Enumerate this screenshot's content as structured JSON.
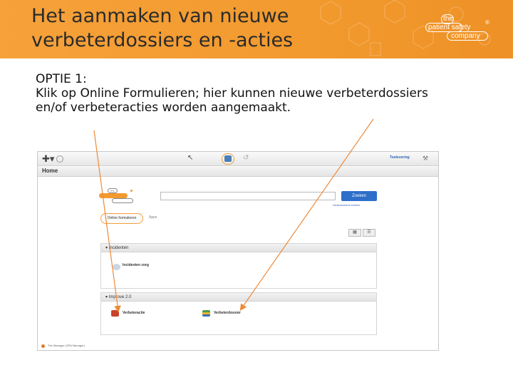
{
  "slide": {
    "title_line1": "Het aanmaken van nieuwe",
    "title_line2": "verbeterdossiers en -acties",
    "body_line1": "OPTIE 1:",
    "body_line2": "Klik op Online Formulieren; hier kunnen nieuwe verbeterdossiers",
    "body_line3": "en/of verbeteracties worden aangemaakt."
  },
  "logo": {
    "word1": "the",
    "word2": "patient safety",
    "word3": "company",
    "registered": "®"
  },
  "screenshot": {
    "toolbar": {
      "user_link": "Toelevering"
    },
    "home_title": "Home",
    "mini_logo_text": "the",
    "search": {
      "placeholder": "",
      "button_label": "Zoeken",
      "advanced_link": "Geavanceerd zoeken"
    },
    "tabs": [
      {
        "label": "Online formulieren",
        "active": true
      },
      {
        "label": "Apps",
        "active": false
      }
    ],
    "panels": [
      {
        "header": "▾ Incidenten",
        "items": [
          {
            "label": "Incidenten zorg",
            "icon": "person-icon"
          }
        ]
      },
      {
        "header": "▾ Improve 2.0",
        "items": [
          {
            "label": "Verbeteractie",
            "icon": "book-red-icon"
          },
          {
            "label": "Verbeterdossier",
            "icon": "book-stack-icon"
          }
        ]
      }
    ],
    "status_text": "The Manager (SPA Manager)"
  },
  "colors": {
    "header_orange": "#f29a2e",
    "arrow_orange": "#ee8a3a",
    "button_blue": "#2d6ec9"
  }
}
